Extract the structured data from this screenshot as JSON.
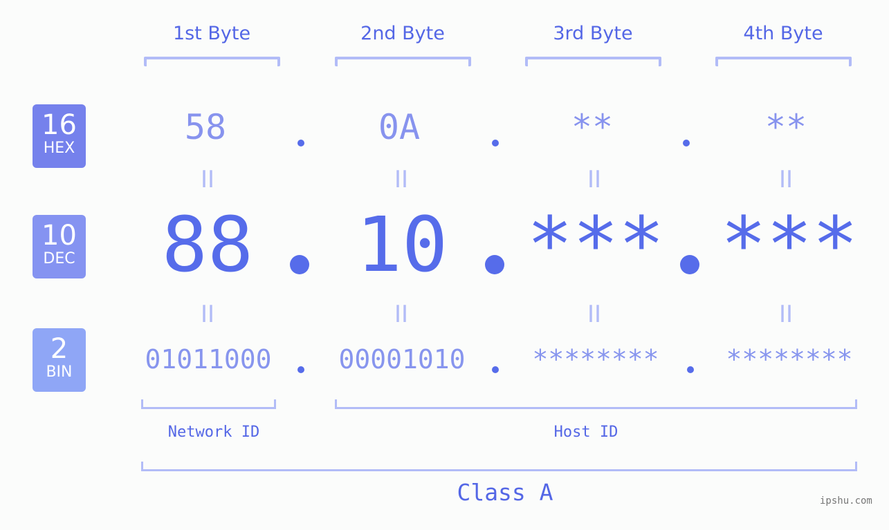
{
  "ip_address": "88.10.***.***",
  "byte_headers": [
    "1st Byte",
    "2nd Byte",
    "3rd Byte",
    "4th Byte"
  ],
  "badges": {
    "hex": {
      "number": "16",
      "label": "HEX",
      "color": "#7581ec"
    },
    "dec": {
      "number": "10",
      "label": "DEC",
      "color": "#8593f1"
    },
    "bin": {
      "number": "2",
      "label": "BIN",
      "color": "#8fa6f6"
    }
  },
  "hex_values": [
    "58",
    "0A",
    "**",
    "**"
  ],
  "dec_values": [
    "88",
    "10",
    "***",
    "***"
  ],
  "bin_values": [
    "01011000",
    "00001010",
    "********",
    "********"
  ],
  "equals_sign": "II",
  "network_id_label": "Network ID",
  "host_id_label": "Host ID",
  "class_label": "Class A",
  "watermark": "ipshu.com",
  "colors": {
    "accent": "#566cea",
    "light_accent": "#8793ee",
    "bracket": "#b2bcf7",
    "background": "#fbfcfb"
  }
}
